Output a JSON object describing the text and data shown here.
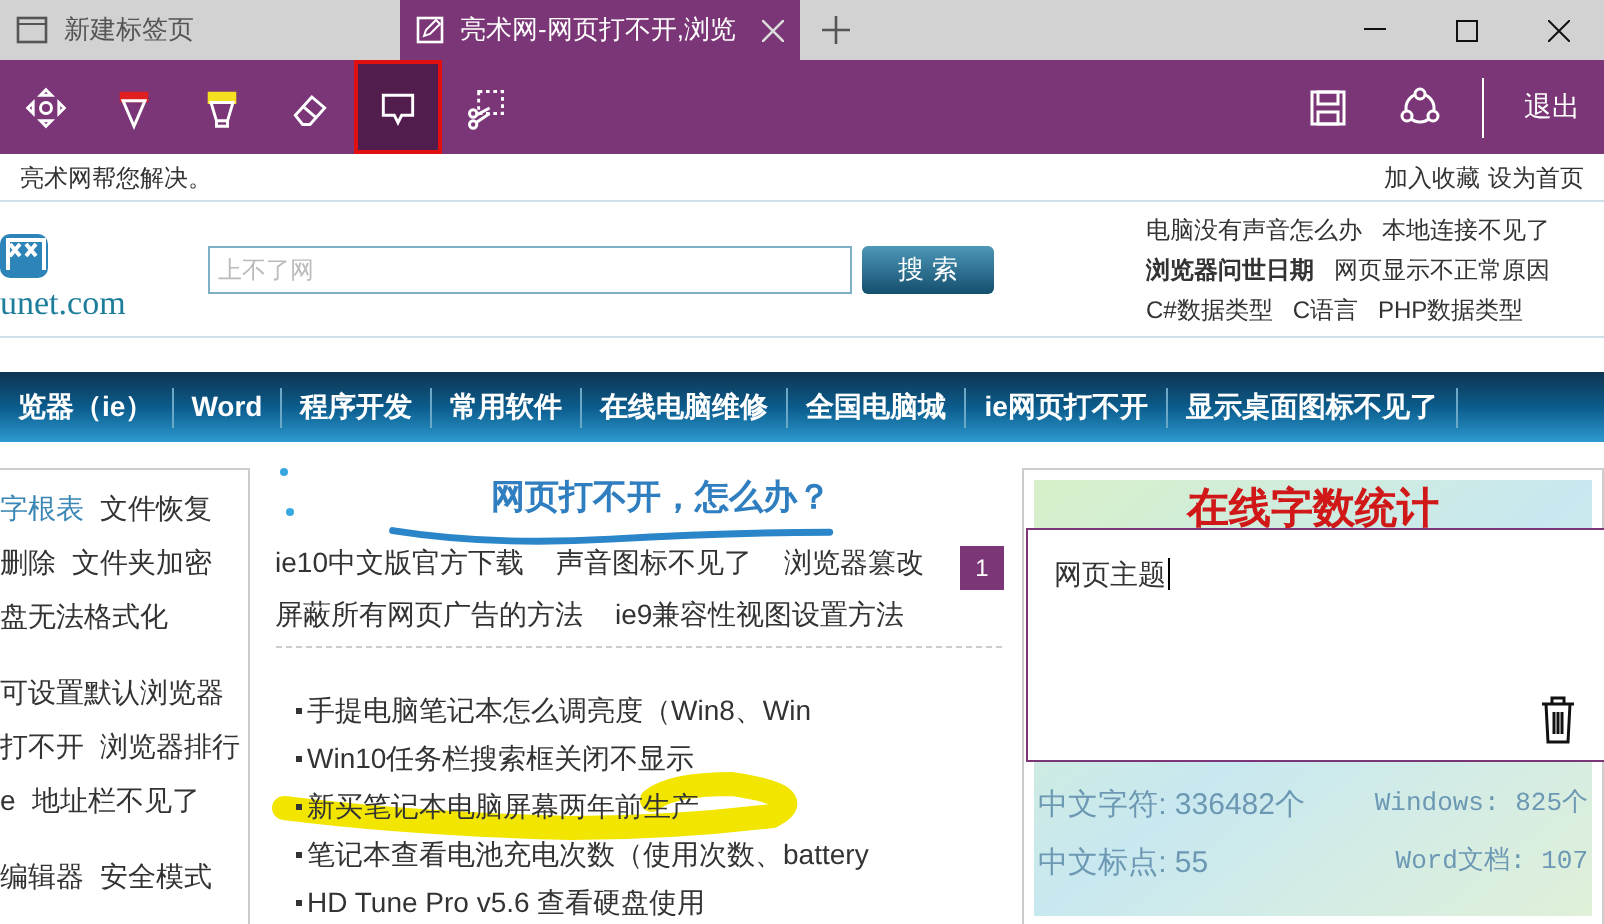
{
  "tabs": [
    {
      "label": "新建标签页",
      "selected": false
    },
    {
      "label": "亮术网-网页打不开,浏览",
      "selected": true
    }
  ],
  "toolbar": {
    "tools": [
      {
        "kind": "pan",
        "selected": false
      },
      {
        "kind": "pen",
        "selected": false
      },
      {
        "kind": "highlighter",
        "selected": false
      },
      {
        "kind": "eraser",
        "selected": false
      },
      {
        "kind": "comment",
        "selected": true
      },
      {
        "kind": "clip",
        "selected": false
      }
    ],
    "exit": "退出"
  },
  "page": {
    "top_left": "亮术网帮您解决。",
    "top_right": [
      "加入收藏",
      "设为首页"
    ],
    "logo_text": "unet.com",
    "search": {
      "placeholder": "上不了网",
      "button": "搜 索"
    },
    "header_links": [
      [
        {
          "text": "电脑没有声音怎么办",
          "bold": false
        },
        {
          "text": "本地连接不见了",
          "bold": false
        }
      ],
      [
        {
          "text": "浏览器问世日期",
          "bold": true
        },
        {
          "text": "网页显示不正常原因",
          "bold": false
        }
      ],
      [
        {
          "text": "C#数据类型",
          "bold": false
        },
        {
          "text": "C语言",
          "bold": false
        },
        {
          "text": "PHP数据类型",
          "bold": false
        }
      ]
    ],
    "nav": [
      "览器（ie）",
      "Word",
      "程序开发",
      "常用软件",
      "在线电脑维修",
      "全国电脑城",
      "ie网页打不开",
      "显示桌面图标不见了"
    ],
    "left_link_groups": [
      [
        [
          {
            "text": "字根表",
            "highlighted": true
          },
          {
            "text": "文件恢复",
            "highlighted": false
          }
        ],
        [
          {
            "text": "删除",
            "highlighted": false
          },
          {
            "text": "文件夹加密",
            "highlighted": false
          }
        ],
        [
          {
            "text": "盘无法格式化",
            "highlighted": false
          }
        ]
      ],
      [
        [
          {
            "text": "可设置默认浏览器",
            "highlighted": false
          }
        ],
        [
          {
            "text": "打不开",
            "highlighted": false
          },
          {
            "text": "浏览器排行",
            "highlighted": false
          }
        ],
        [
          {
            "text": "e",
            "highlighted": false
          },
          {
            "text": "地址栏不见了",
            "highlighted": false
          }
        ]
      ],
      [
        [
          {
            "text": "编辑器",
            "highlighted": false
          },
          {
            "text": "安全模式",
            "highlighted": false
          }
        ]
      ]
    ],
    "heading": "网页打不开，怎么办？",
    "topic_links": [
      [
        "ie10中文版官方下载",
        "声音图标不见了",
        "浏览器篡改"
      ],
      [
        "屏蔽所有网页广告的方法",
        "ie9兼容性视图设置方法"
      ]
    ],
    "articles": [
      "手提电脑笔记本怎么调亮度（Win8、Win",
      "Win10任务栏搜索框关闭不显示",
      "新买笔记本电脑屏幕两年前生产",
      "笔记本查看电池充电次数（使用次数、battery",
      "HD Tune Pro v5.6 查看硬盘使用"
    ],
    "counter": {
      "title": "在线字数统计",
      "stats": [
        [
          "中文字符: 336482个",
          "Windows: 825个"
        ],
        [
          "中文标点: 55",
          "Word文档: 107"
        ]
      ]
    },
    "note": {
      "number": "1",
      "text": "网页主题"
    }
  }
}
